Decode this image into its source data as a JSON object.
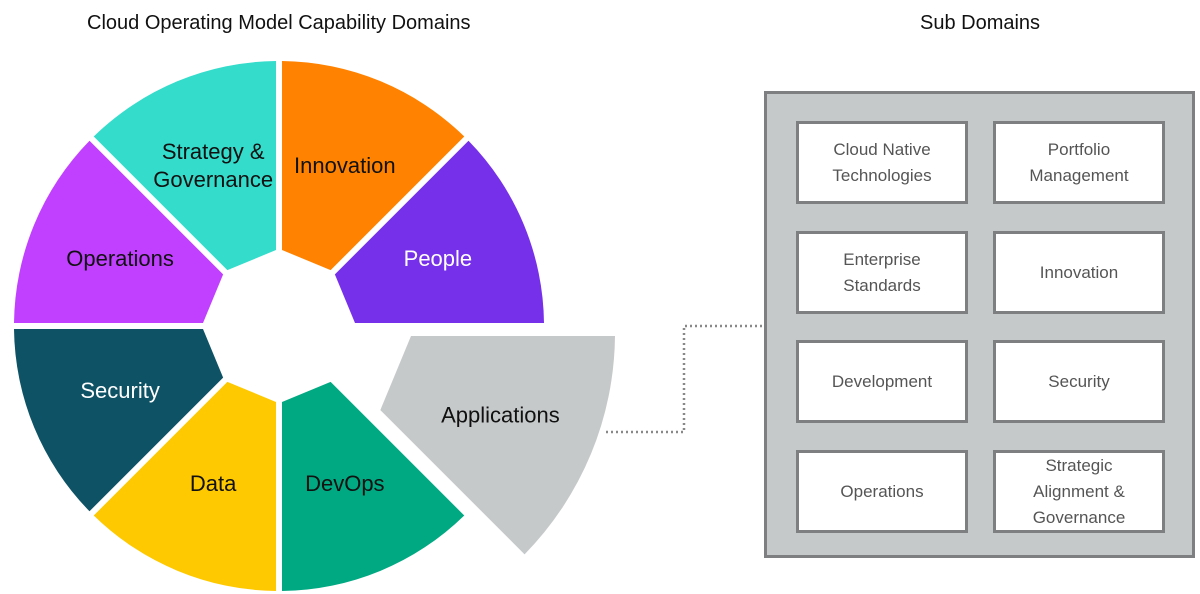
{
  "titles": {
    "left": "Cloud Operating Model Capability Domains",
    "right": "Sub Domains"
  },
  "domains": [
    {
      "label": "Innovation",
      "color": "#ff8300",
      "text_color": "#111111"
    },
    {
      "label": "People",
      "color": "#7630ea",
      "text_color": "#ffffff"
    },
    {
      "label": "Applications",
      "color": "#c6c9ca",
      "text_color": "#111111",
      "highlighted": true
    },
    {
      "label": "DevOps",
      "color": "#01a982",
      "text_color": "#111111"
    },
    {
      "label": "Data",
      "color": "#fec901",
      "text_color": "#111111"
    },
    {
      "label": "Security",
      "color": "#0e5265",
      "text_color": "#ffffff"
    },
    {
      "label": "Operations",
      "color": "#c140ff",
      "text_color": "#111111"
    },
    {
      "label": "Strategy &\nGovernance",
      "color": "#33dccb",
      "text_color": "#111111"
    }
  ],
  "sub_domains": [
    "Cloud Native\nTechnologies",
    "Portfolio\nManagement",
    "Enterprise\nStandards",
    "Innovation",
    "Development",
    "Security",
    "Operations",
    "Strategic\nAlignment &\nGovernance"
  ]
}
